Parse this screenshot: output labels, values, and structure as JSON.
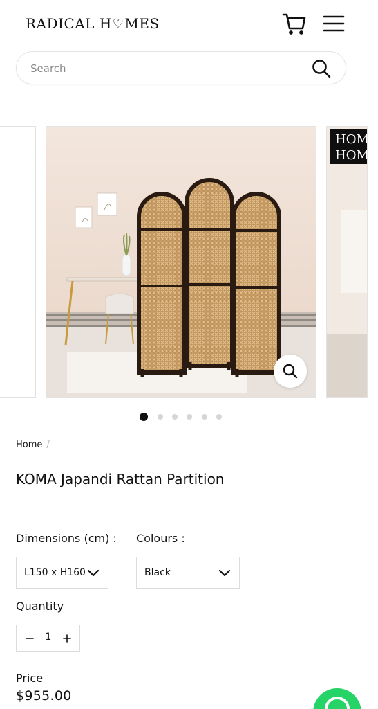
{
  "header": {
    "logo_left": "RADICAL H",
    "logo_heart": "♡",
    "logo_right": "MES",
    "icons": {
      "cart": "cart-icon",
      "menu": "hamburger-menu-icon"
    }
  },
  "search": {
    "placeholder": "Search",
    "value": "",
    "icon": "search-icon"
  },
  "gallery": {
    "slide_count": 6,
    "active_index": 0,
    "next_slide_badge": [
      "HOM",
      "HOM"
    ],
    "zoom_icon": "zoom-icon"
  },
  "breadcrumb": {
    "home": "Home",
    "separator": "/"
  },
  "product": {
    "title": "KOMA Japandi Rattan Partition",
    "dimensions_label": "Dimensions (cm) :",
    "dimensions_value": "L150 x H160",
    "colours_label": "Colours :",
    "colours_value": "Black",
    "quantity_label": "Quantity",
    "quantity_value": "1",
    "price_label": "Price",
    "price": "$955.00"
  },
  "floating": {
    "icon": "whatsapp-icon"
  },
  "colors": {
    "text": "#111111",
    "border": "#dcdcdc",
    "dot_active": "#111111",
    "dot_inactive": "#d6d6d6",
    "whatsapp": "#25d366"
  }
}
